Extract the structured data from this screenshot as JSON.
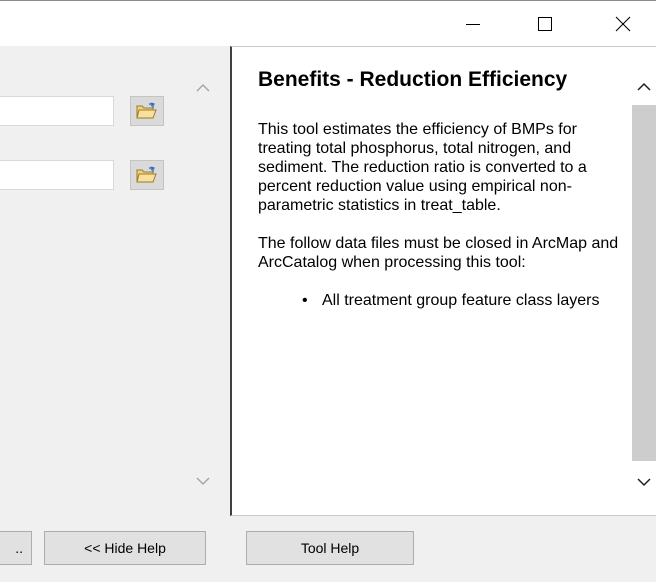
{
  "window": {
    "minimize_icon": "minimize-icon",
    "maximize_icon": "maximize-icon",
    "close_icon": "close-icon"
  },
  "left_pane": {
    "fields": [
      {
        "value": "",
        "icon": "folder-open-icon"
      },
      {
        "value": "",
        "icon": "folder-open-icon"
      }
    ]
  },
  "help": {
    "title": "Benefits - Reduction Efficiency",
    "paragraph1": "This tool estimates the efficiency of BMPs for treating total phosphorus, total nitrogen, and sediment. The reduction ratio is converted to a percent reduction value using empirical non-parametric statistics in treat_table.",
    "paragraph2": "The follow data files must be closed in ArcMap and ArcCatalog when processing this tool:",
    "list": [
      "All treatment group feature class layers"
    ]
  },
  "buttons": {
    "partial_label": "..",
    "hide_help_label": "<< Hide Help",
    "tool_help_label": "Tool Help"
  },
  "colors": {
    "background": "#f0f0f0",
    "scroll_thumb": "#cdcdcd",
    "button_face": "#e1e1e1"
  }
}
